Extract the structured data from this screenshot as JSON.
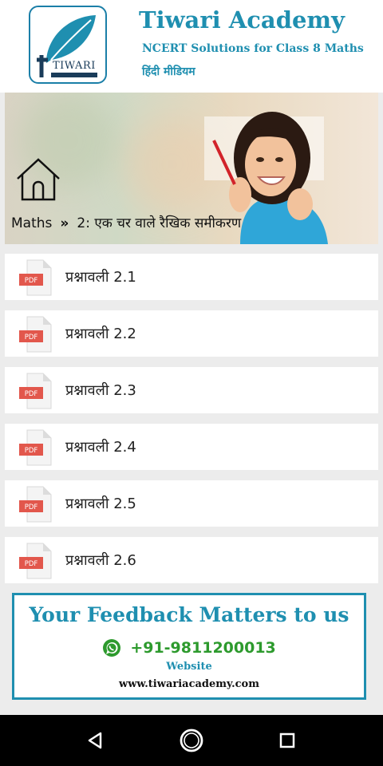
{
  "header": {
    "title": "Tiwari Academy",
    "subtitle": "NCERT Solutions for Class 8 Maths",
    "medium": "हिंदी मीडियम",
    "logo_text": "TIWARI"
  },
  "breadcrumb": {
    "root": "Maths",
    "separator": "»",
    "chapter": "2: एक चर वाले रैखिक समीकरण"
  },
  "exercises": [
    {
      "label": "प्रश्नावली 2.1",
      "icon": "pdf-icon"
    },
    {
      "label": "प्रश्नावली 2.2",
      "icon": "pdf-icon"
    },
    {
      "label": "प्रश्नावली 2.3",
      "icon": "pdf-icon"
    },
    {
      "label": "प्रश्नावली 2.4",
      "icon": "pdf-icon"
    },
    {
      "label": "प्रश्नावली 2.5",
      "icon": "pdf-icon"
    },
    {
      "label": "प्रश्नावली 2.6",
      "icon": "pdf-icon"
    }
  ],
  "pdf_badge": "PDF",
  "feedback": {
    "title": "Your Feedback Matters to us",
    "phone": "+91-9811200013",
    "website_label": "Website",
    "url": "www.tiwariacademy.com"
  },
  "navbar": {
    "back": "back-icon",
    "home": "home-circle-icon",
    "recents": "recents-icon"
  },
  "colors": {
    "brand": "#1f8fb0",
    "whatsapp": "#2d9a2d",
    "pdf_red": "#e2574c"
  }
}
